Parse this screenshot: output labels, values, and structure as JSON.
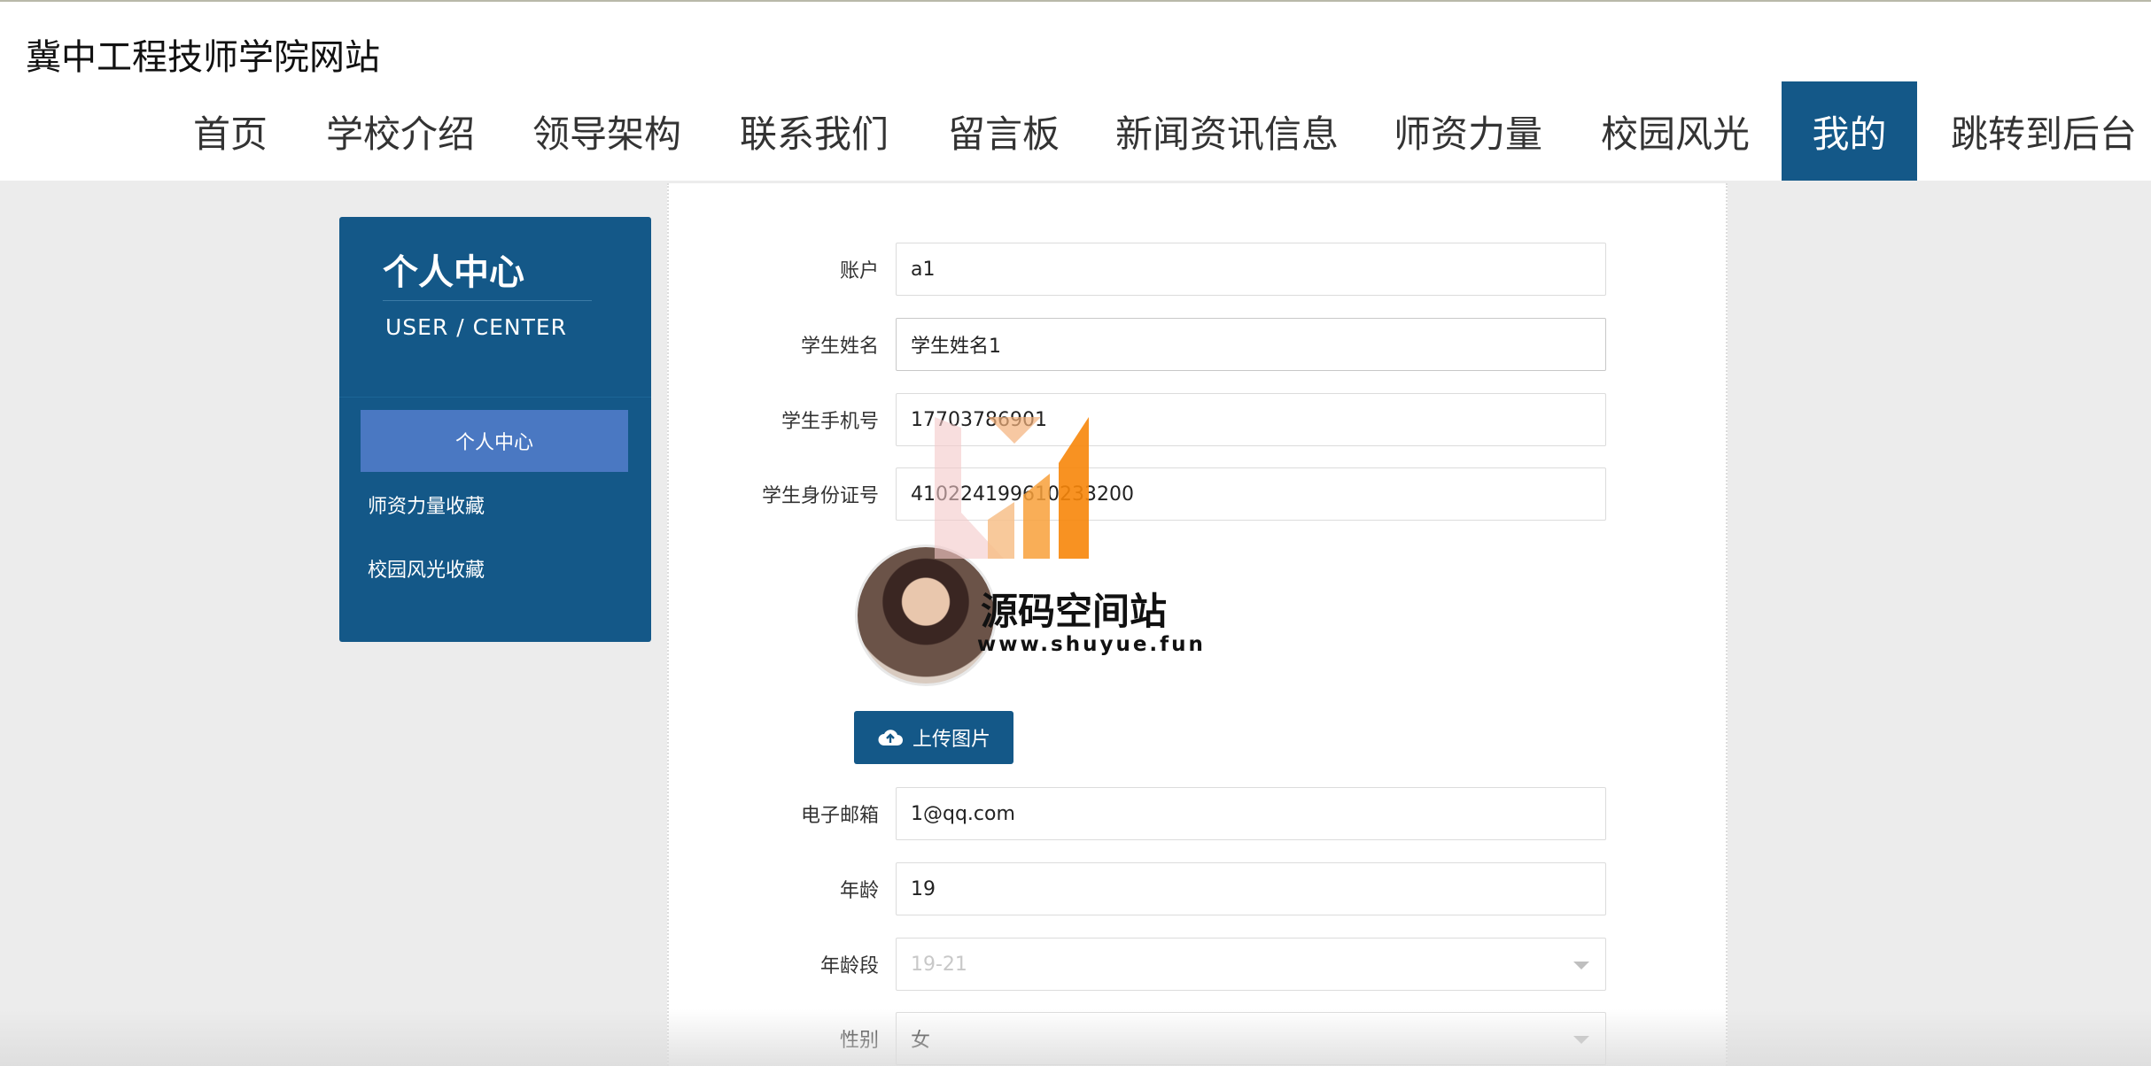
{
  "site": {
    "title": "冀中工程技师学院网站"
  },
  "nav": {
    "items": [
      {
        "label": "首页"
      },
      {
        "label": "学校介绍"
      },
      {
        "label": "领导架构"
      },
      {
        "label": "联系我们"
      },
      {
        "label": "留言板"
      },
      {
        "label": "新闻资讯信息"
      },
      {
        "label": "师资力量"
      },
      {
        "label": "校园风光"
      },
      {
        "label": "我的",
        "active": true
      },
      {
        "label": "跳转到后台"
      }
    ]
  },
  "sidebar": {
    "title": "个人中心",
    "subtitle": "USER / CENTER",
    "items": [
      {
        "label": "个人中心",
        "active": true
      },
      {
        "label": "师资力量收藏"
      },
      {
        "label": "校园风光收藏"
      }
    ]
  },
  "form": {
    "account": {
      "label": "账户",
      "value": "a1"
    },
    "name": {
      "label": "学生姓名",
      "value": "学生姓名1"
    },
    "phone": {
      "label": "学生手机号",
      "value": "17703786901"
    },
    "id_card": {
      "label": "学生身份证号",
      "value": "410224199610233200"
    },
    "upload_label": "上传图片",
    "email": {
      "label": "电子邮箱",
      "value": "1@qq.com"
    },
    "age": {
      "label": "年龄",
      "value": "19"
    },
    "age_group": {
      "label": "年龄段",
      "value": "19-21"
    },
    "gender": {
      "label": "性别",
      "value": "女"
    }
  },
  "watermark": {
    "title": "源码空间站",
    "url": "www.shuyue.fun"
  },
  "colors": {
    "primary": "#145888",
    "active_sidebar": "#4a78c2",
    "background": "#ececec"
  }
}
